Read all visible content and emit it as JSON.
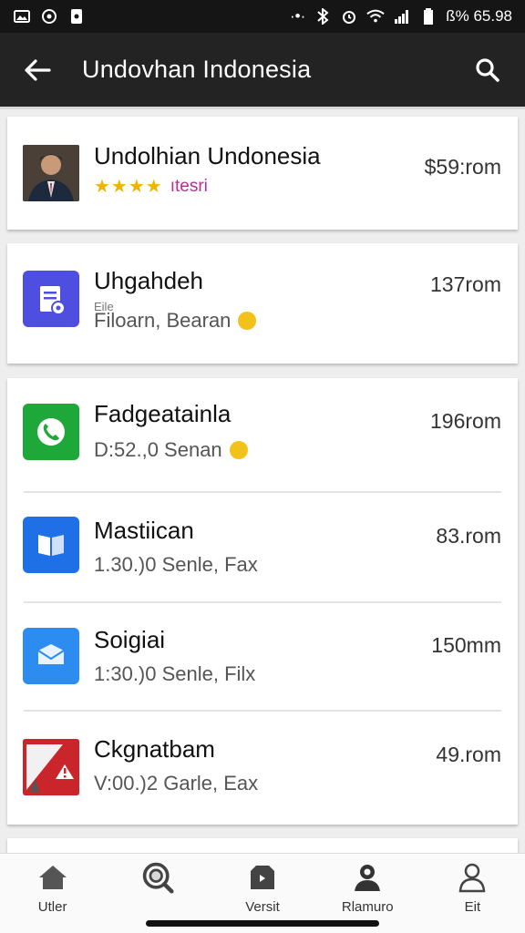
{
  "status_bar": {
    "left_icons": [
      "gallery-icon",
      "messenger-icon",
      "lock-icon"
    ],
    "right_text": "·•·",
    "battery_text": "ß% 65.98"
  },
  "app_bar": {
    "title": "Undovhan Indonesia"
  },
  "items": [
    {
      "name": "Undolhian Undonesia",
      "stars": "★★★★",
      "rating_text": "ıtesri",
      "size": "$59:rom",
      "icon": "profile-photo"
    },
    {
      "name": "Uhgahdeh",
      "file_tag": "Eile",
      "subtitle": "Filoarn, Bearan",
      "coin": true,
      "size": "137rom",
      "icon": "document-icon"
    },
    {
      "name": "Fadgeatainla",
      "subtitle": "D:52.,0 Senan",
      "coin": true,
      "size": "196rom",
      "icon": "phone-icon"
    },
    {
      "name": "Mastiican",
      "subtitle": "1.30.)0 Senle, Fax",
      "size": "83.rom",
      "icon": "book-icon"
    },
    {
      "name": "Soigiai",
      "subtitle": "1:30.)0 Senle, Filx",
      "size": "150mm",
      "icon": "mail-icon"
    },
    {
      "name": "Ckgnatbam",
      "subtitle": "V:00.)2 Garle, Eax",
      "size": "49.rom",
      "icon": "warning-icon"
    }
  ],
  "bottom_nav": [
    {
      "label": "Utler",
      "icon": "home-icon"
    },
    {
      "label": "",
      "icon": "search-icon"
    },
    {
      "label": "Versit",
      "icon": "shop-icon"
    },
    {
      "label": "Rlamuro",
      "icon": "user-search-icon"
    },
    {
      "label": "Eit",
      "icon": "person-icon"
    }
  ],
  "colors": {
    "appbar": "#232323",
    "statusbar": "#151515",
    "coin": "#f2c21b",
    "stars": "#f0b400",
    "rating": "#b0348e"
  }
}
